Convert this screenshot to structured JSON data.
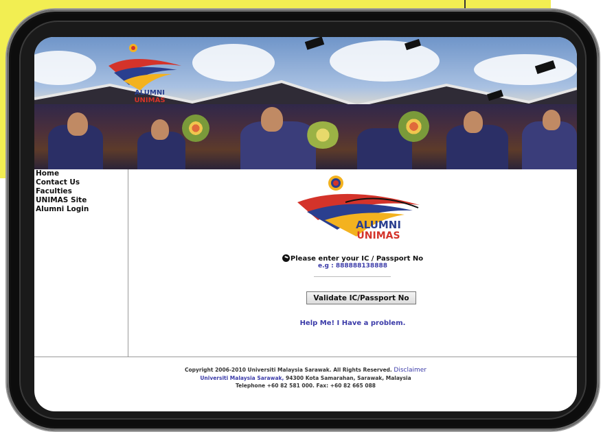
{
  "header_text": "",
  "nav": {
    "items": [
      {
        "label": "Home"
      },
      {
        "label": "Contact Us"
      },
      {
        "label": "Faculties"
      },
      {
        "label": "UNIMAS Site"
      },
      {
        "label": "Alumni Login"
      }
    ]
  },
  "logo": {
    "line1": "ALUMNI",
    "line2": "UNIMAS"
  },
  "form": {
    "prompt": "Please enter your IC / Passport No",
    "example": "e.g : 888888138888",
    "validate_button": "Validate IC/Passport No",
    "help_link": "Help Me! I Have a problem."
  },
  "footer": {
    "copyright": "Copyright 2006-2010 Universiti Malaysia Sarawak. All Rights Reserved.",
    "disclaimer": "Disclaimer",
    "university": "Universiti Malaysia Sarawak,",
    "address": " 94300 Kota Samarahan, Sarawak, Malaysia",
    "contact": "Telephone +60 82 581 000. Fax: +60 82 665 088"
  },
  "colors": {
    "highlight": "#f2ee52",
    "link_blue": "#3a3aa8",
    "tablet_frame": "#0d0d0d",
    "logo_red": "#d4332a",
    "logo_blue": "#2a3f8f",
    "logo_yellow": "#f3b21f"
  }
}
